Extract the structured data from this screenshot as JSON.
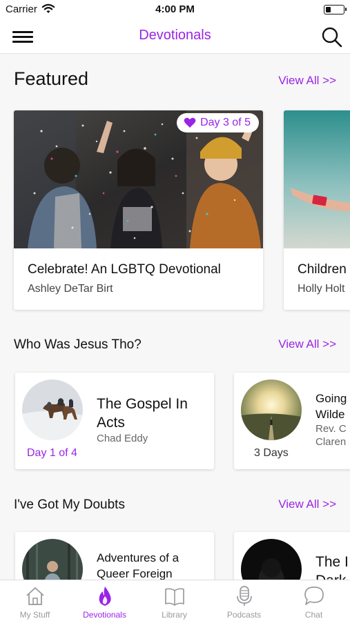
{
  "status_bar": {
    "carrier": "Carrier",
    "time": "4:00 PM"
  },
  "nav": {
    "title": "Devotionals"
  },
  "sections": [
    {
      "title": "Featured",
      "view_all": "View All >>",
      "cards": [
        {
          "title": "Celebrate! An LGBTQ Devotional",
          "author": "Ashley DeTar Birt",
          "progress": "Day 3 of 5"
        },
        {
          "title": "Children",
          "author": "Holly Holt"
        }
      ]
    },
    {
      "title": "Who Was Jesus Tho?",
      "view_all": "View All >>",
      "cards": [
        {
          "title_line1": "The Gospel In",
          "title_line2": "Acts",
          "author": "Chad Eddy",
          "progress": "Day 1 of 4"
        },
        {
          "title_line1": "Going",
          "title_line2": "Wilde",
          "author_line1": "Rev. C",
          "author_line2": "Claren",
          "progress": "3 Days"
        }
      ]
    },
    {
      "title": "I've Got My Doubts",
      "view_all": "View All >>",
      "cards": [
        {
          "title_line1": "Adventures of a",
          "title_line2": "Queer Foreign"
        },
        {
          "title_line1": "The I",
          "title_line2": "Dark"
        }
      ]
    }
  ],
  "tabs": [
    {
      "label": "My Stuff",
      "icon": "house-icon"
    },
    {
      "label": "Devotionals",
      "icon": "flame-icon",
      "active": true
    },
    {
      "label": "Library",
      "icon": "book-icon"
    },
    {
      "label": "Podcasts",
      "icon": "microphone-icon"
    },
    {
      "label": "Chat",
      "icon": "chat-bubble-icon"
    }
  ],
  "colors": {
    "accent": "#9a24e6",
    "tab_inactive": "#9a9a9e"
  }
}
